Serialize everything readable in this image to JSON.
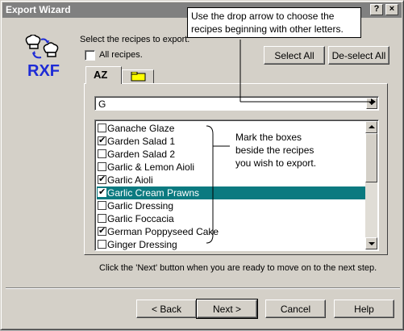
{
  "window": {
    "title": "Export Wizard"
  },
  "logo": {
    "text": "RXF"
  },
  "header": {
    "instruction": "Select the recipes to export.",
    "all_recipes_label": "All recipes.",
    "select_all_label": "Select All",
    "deselect_all_label": "De-select All"
  },
  "tabs": [
    {
      "label": "AZ",
      "active": true
    },
    {
      "label": "",
      "active": false
    }
  ],
  "combo": {
    "value": "G"
  },
  "callout_top": {
    "line1": "Use the drop arrow to choose the",
    "line2": "recipes beginning with other letters."
  },
  "callout_list": {
    "line1": "Mark the boxes",
    "line2": "beside the recipes",
    "line3": "you wish to export."
  },
  "recipes": [
    {
      "name": "Ganache Glaze",
      "checked": false,
      "selected": false
    },
    {
      "name": "Garden Salad 1",
      "checked": true,
      "selected": false
    },
    {
      "name": "Garden Salad 2",
      "checked": false,
      "selected": false
    },
    {
      "name": "Garlic & Lemon Aioli",
      "checked": false,
      "selected": false
    },
    {
      "name": "Garlic Aioli",
      "checked": true,
      "selected": false
    },
    {
      "name": "Garlic Cream Prawns",
      "checked": true,
      "selected": true
    },
    {
      "name": "Garlic Dressing",
      "checked": false,
      "selected": false
    },
    {
      "name": "Garlic Foccacia",
      "checked": false,
      "selected": false
    },
    {
      "name": "German Poppyseed Cake",
      "checked": true,
      "selected": false
    },
    {
      "name": "Ginger Dressing",
      "checked": false,
      "selected": false
    }
  ],
  "footer_note": "Click the 'Next' button when you are ready to move on to the next step.",
  "buttons": {
    "back": "< Back",
    "next": "Next >",
    "cancel": "Cancel",
    "help": "Help"
  },
  "colors": {
    "selection": "#0b7a80",
    "logo": "#1e2bd6",
    "titlebar": "#808080"
  }
}
